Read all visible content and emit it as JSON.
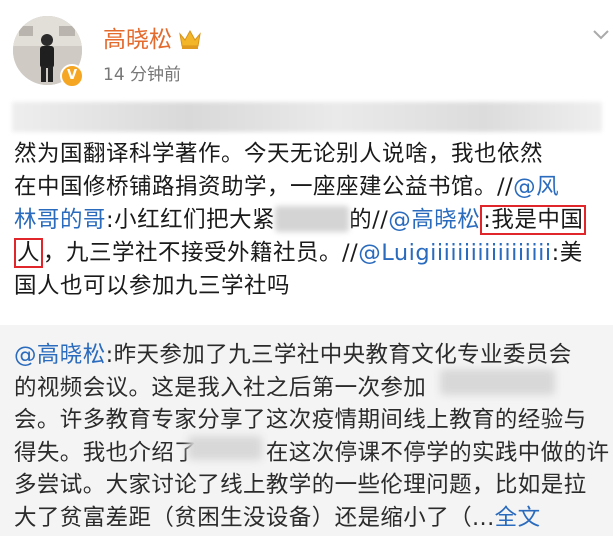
{
  "header": {
    "username": "高晓松",
    "timestamp": "14 分钟前",
    "verified_badge": "V",
    "accent_color": "#e46b2e"
  },
  "post": {
    "lines": [
      [
        {
          "t": "然为国翻译科学著作。今天无论别人说啥，我也依然"
        }
      ],
      [
        {
          "t": "在中国修桥铺路捐资助学，一座座建公益书馆。//"
        },
        {
          "t": "@风",
          "link": true
        }
      ],
      [
        {
          "t": "林哥的哥",
          "link": true
        },
        {
          "t": ":小红红们把大紧"
        },
        {
          "blur": true
        },
        {
          "t": "的//"
        },
        {
          "t": "@高晓松",
          "link": true
        },
        {
          "t": ":我是中国",
          "hl": true
        }
      ],
      [
        {
          "t": "人",
          "hl": true
        },
        {
          "t": "，九三学社不接受外籍社员。//"
        },
        {
          "t": "@Luigiiiiiiiiiiiiiiiiii",
          "link": true
        },
        {
          "t": ":美"
        }
      ],
      [
        {
          "t": "国人也可以参加九三学社吗"
        }
      ]
    ]
  },
  "quote": {
    "lines": [
      [
        {
          "t": "@高晓松",
          "link": true
        },
        {
          "t": ":昨天参加了九三学社中央教育文化专业委员会"
        }
      ],
      [
        {
          "t": "的视频会议。这是我入社之后第一次参加"
        }
      ],
      [
        {
          "t": "会。许多教育专家分享了这次疫情期间线上教育的经验与"
        }
      ],
      [
        {
          "t": "得失。我也介绍了"
        },
        {
          "t": "　　　"
        },
        {
          "t": "在这次停课不停学的实践中做的许"
        }
      ],
      [
        {
          "t": "多尝试。大家讨论了线上教学的一些伦理问题，比如是拉"
        }
      ],
      [
        {
          "t": "大了贫富差距（贫困生没设备）还是缩小了（..."
        },
        {
          "t": "全文",
          "link": true
        }
      ]
    ]
  }
}
